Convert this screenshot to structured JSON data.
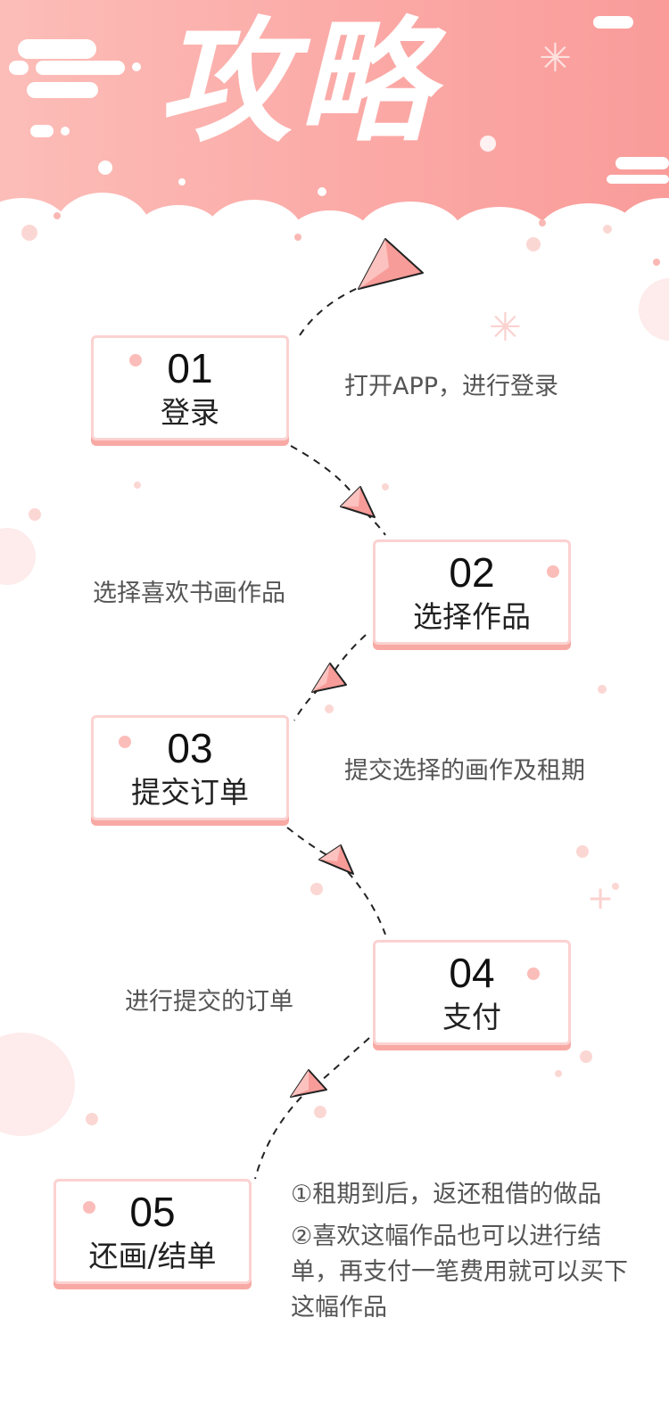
{
  "header": {
    "title": "攻略"
  },
  "steps": [
    {
      "num": "01",
      "name": "登录",
      "desc": "打开APP，进行登录"
    },
    {
      "num": "02",
      "name": "选择作品",
      "desc": "选择喜欢书画作品"
    },
    {
      "num": "03",
      "name": "提交订单",
      "desc": "提交选择的画作及租期"
    },
    {
      "num": "04",
      "name": "支付",
      "desc": "进行提交的订单"
    },
    {
      "num": "05",
      "name": "还画/结单",
      "desc_line1": "①租期到后，返还租借的做品",
      "desc_line2": "②喜欢这幅作品也可以进行结单，再支付一笔费用就可以买下这幅作品"
    }
  ],
  "colors": {
    "header_start": "#fcbdb8",
    "header_end": "#f99c9a",
    "card_border": "#fbd2d0",
    "card_shadow": "#f8a9a4",
    "plane": "#f89c99",
    "text_dark": "#222222",
    "text_desc": "#555555"
  },
  "icons": [
    "paper-plane-icon",
    "sparkle-icon",
    "plus-icon"
  ]
}
